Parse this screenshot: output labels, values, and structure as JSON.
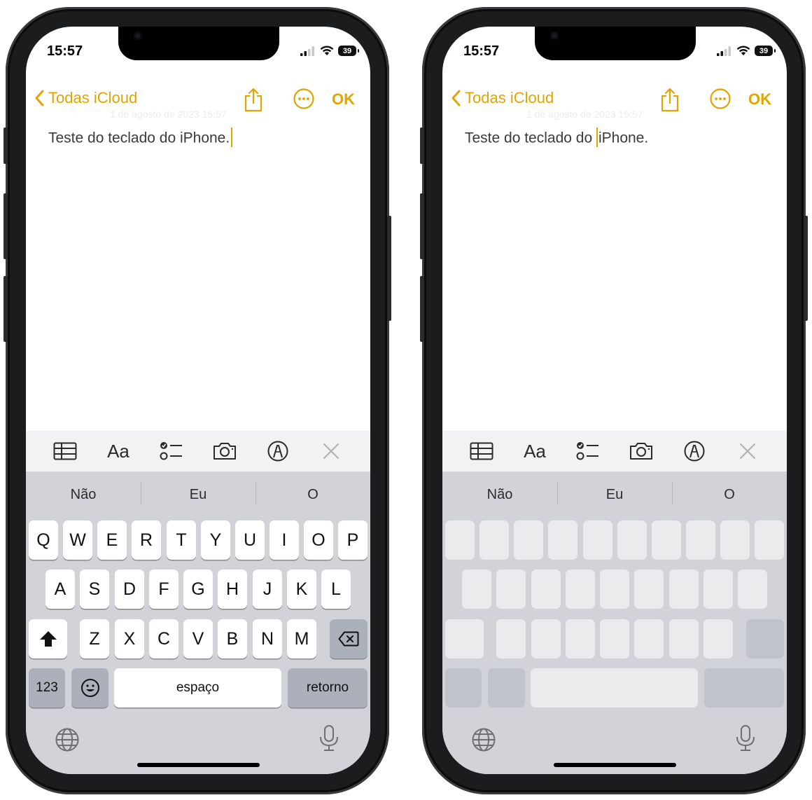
{
  "status": {
    "time": "15:57",
    "battery": "39"
  },
  "nav": {
    "back_label": "Todas iCloud",
    "ok_label": "OK"
  },
  "ghost_date": "1 de agosto de 2023 15:57",
  "note_text_full": "Teste do teclado do iPhone.",
  "note_text_before": "Teste do teclado do ",
  "note_text_after": "iPhone.",
  "toolbar": {
    "format_label": "Aa"
  },
  "suggestions": [
    "Não",
    "Eu",
    "O"
  ],
  "keys": {
    "row1": [
      "Q",
      "W",
      "E",
      "R",
      "T",
      "Y",
      "U",
      "I",
      "O",
      "P"
    ],
    "row2": [
      "A",
      "S",
      "D",
      "F",
      "G",
      "H",
      "J",
      "K",
      "L"
    ],
    "row3": [
      "Z",
      "X",
      "C",
      "V",
      "B",
      "N",
      "M"
    ],
    "numbers": "123",
    "space": "espaço",
    "return": "retorno"
  },
  "colors": {
    "accent": "#e0a500",
    "keyboard_bg": "#d1d3d9",
    "key_bg": "#ffffff",
    "fn_key_bg": "#abb0bb"
  },
  "icons": [
    "chevron-left-icon",
    "share-icon",
    "more-icon",
    "table-icon",
    "checklist-icon",
    "camera-icon",
    "markup-icon",
    "close-icon",
    "shift-icon",
    "delete-icon",
    "emoji-icon",
    "globe-icon",
    "mic-icon"
  ]
}
